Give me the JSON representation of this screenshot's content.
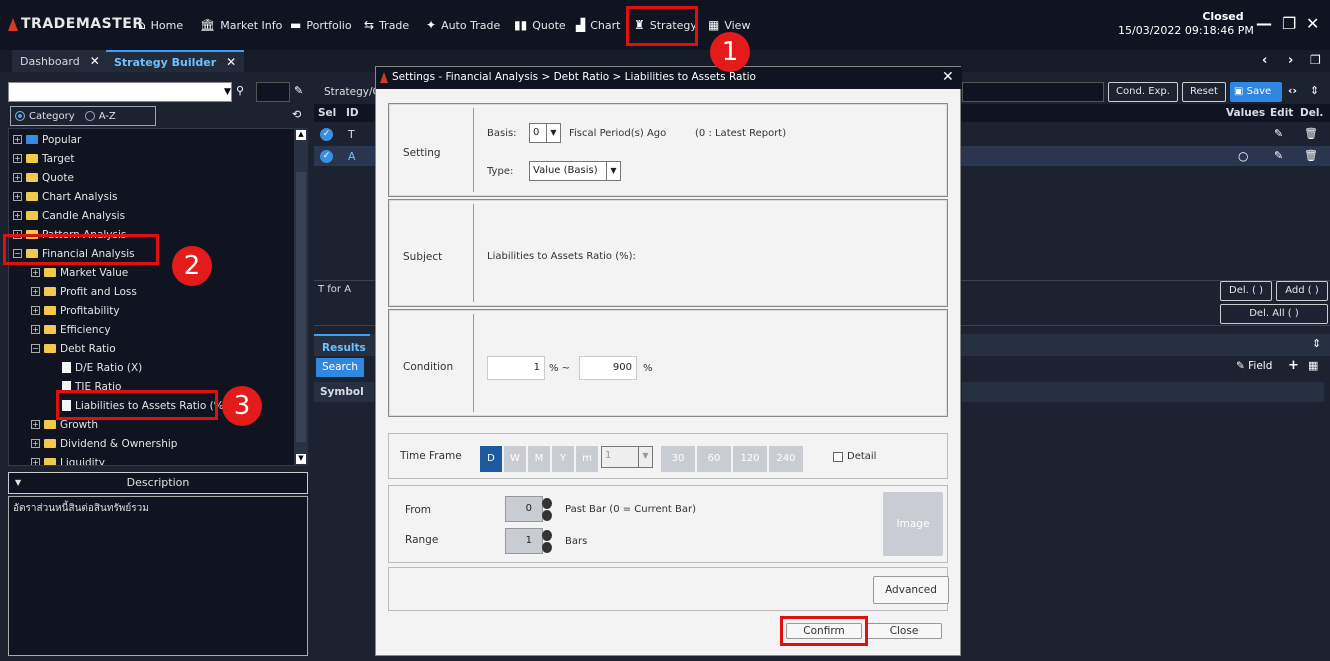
{
  "app": {
    "logo_text": "TRADEMASTER"
  },
  "nav": [
    {
      "label": "Home",
      "icon": "home-icon",
      "glyph": "⌂"
    },
    {
      "label": "Market Info",
      "icon": "bank-icon",
      "glyph": "🏛"
    },
    {
      "label": "Portfolio",
      "icon": "briefcase-icon",
      "glyph": "▬"
    },
    {
      "label": "Trade",
      "icon": "exchange-icon",
      "glyph": "⇆"
    },
    {
      "label": "Auto Trade",
      "icon": "wand-icon",
      "glyph": "✦"
    },
    {
      "label": "Quote",
      "icon": "quote-icon",
      "glyph": "▮▮"
    },
    {
      "label": "Chart",
      "icon": "chart-icon",
      "glyph": "▟"
    },
    {
      "label": "Strategy",
      "icon": "strategy-icon",
      "glyph": "♜"
    },
    {
      "label": "View",
      "icon": "grid-icon",
      "glyph": "▦"
    }
  ],
  "status": {
    "state": "Closed",
    "datetime": "15/03/2022 09:18:46 PM"
  },
  "tabs": [
    {
      "label": "Dashboard"
    },
    {
      "label": "Strategy Builder"
    }
  ],
  "left": {
    "category_label": "Category",
    "az_label": "A-Z",
    "tree": [
      {
        "label": "Popular",
        "level": 0,
        "type": "folder-blue"
      },
      {
        "label": "Target",
        "level": 0,
        "type": "folder"
      },
      {
        "label": "Quote",
        "level": 0,
        "type": "folder"
      },
      {
        "label": "Chart Analysis",
        "level": 0,
        "type": "folder"
      },
      {
        "label": "Candle Analysis",
        "level": 0,
        "type": "folder"
      },
      {
        "label": "Pattern Analysis",
        "level": 0,
        "type": "folder"
      },
      {
        "label": "Financial Analysis",
        "level": 0,
        "type": "folder"
      },
      {
        "label": "Market Value",
        "level": 1,
        "type": "folder"
      },
      {
        "label": "Profit and Loss",
        "level": 1,
        "type": "folder"
      },
      {
        "label": "Profitability",
        "level": 1,
        "type": "folder"
      },
      {
        "label": "Efficiency",
        "level": 1,
        "type": "folder"
      },
      {
        "label": "Debt Ratio",
        "level": 1,
        "type": "folder"
      },
      {
        "label": "D/E Ratio (X)",
        "level": 2,
        "type": "doc"
      },
      {
        "label": "TIE Ratio",
        "level": 2,
        "type": "doc"
      },
      {
        "label": "Liabilities to Assets Ratio (%)",
        "level": 2,
        "type": "doc"
      },
      {
        "label": "Growth",
        "level": 1,
        "type": "folder"
      },
      {
        "label": "Dividend & Ownership",
        "level": 1,
        "type": "folder"
      },
      {
        "label": "Liquidity",
        "level": 1,
        "type": "folder"
      }
    ],
    "description_title": "Description",
    "description_text": "อัตราส่วนหนี้สินต่อสินทรัพย์รวม"
  },
  "main": {
    "strategy_label": "Strategy/C",
    "cond_exp": "Cond. Exp.",
    "reset": "Reset",
    "save": "Save",
    "headers": {
      "sel": "Sel",
      "id": "ID",
      "values": "Values",
      "edit": "Edit",
      "del": "Del."
    },
    "rows": [
      {
        "id": "T"
      },
      {
        "id": "A"
      }
    ],
    "t_for_a": "T for A",
    "del_paren": "Del. ( )",
    "add_paren": "Add ( )",
    "del_all": "Del. All ( )",
    "results": "Results",
    "search": "Search",
    "symbol": "Symbol",
    "field": "Field"
  },
  "dialog": {
    "title": "Settings - Financial Analysis > Debt Ratio > Liabilities to Assets Ratio",
    "setting_label": "Setting",
    "basis_label": "Basis:",
    "basis_value": "0",
    "fiscal_label": "Fiscal Period(s) Ago",
    "latest_note": "(0 : Latest Report)",
    "type_label": "Type:",
    "type_value": "Value (Basis)",
    "subject_label": "Subject",
    "subject_value": "Liabilities to Assets Ratio (%):",
    "condition_label": "Condition",
    "cond_min": "1",
    "cond_sep": "% ~",
    "cond_max": "900",
    "cond_unit": "%",
    "timeframe_label": "Time Frame",
    "tf_buttons": [
      "D",
      "W",
      "M",
      "Y",
      "m"
    ],
    "tf_minute_value": "1",
    "tf_numbers": [
      "30",
      "60",
      "120",
      "240"
    ],
    "detail_label": "Detail",
    "from_label": "From",
    "from_value": "0",
    "from_note": "Past Bar (0 = Current Bar)",
    "range_label": "Range",
    "range_value": "1",
    "range_note": "Bars",
    "image_label": "Image",
    "advanced_label": "Advanced",
    "confirm_label": "Confirm",
    "close_label": "Close"
  },
  "annotations": [
    "1",
    "2",
    "3"
  ],
  "colors": {
    "accent": "#3aa0ff",
    "highlight": "#e01010",
    "topbar": "#0f1420"
  }
}
